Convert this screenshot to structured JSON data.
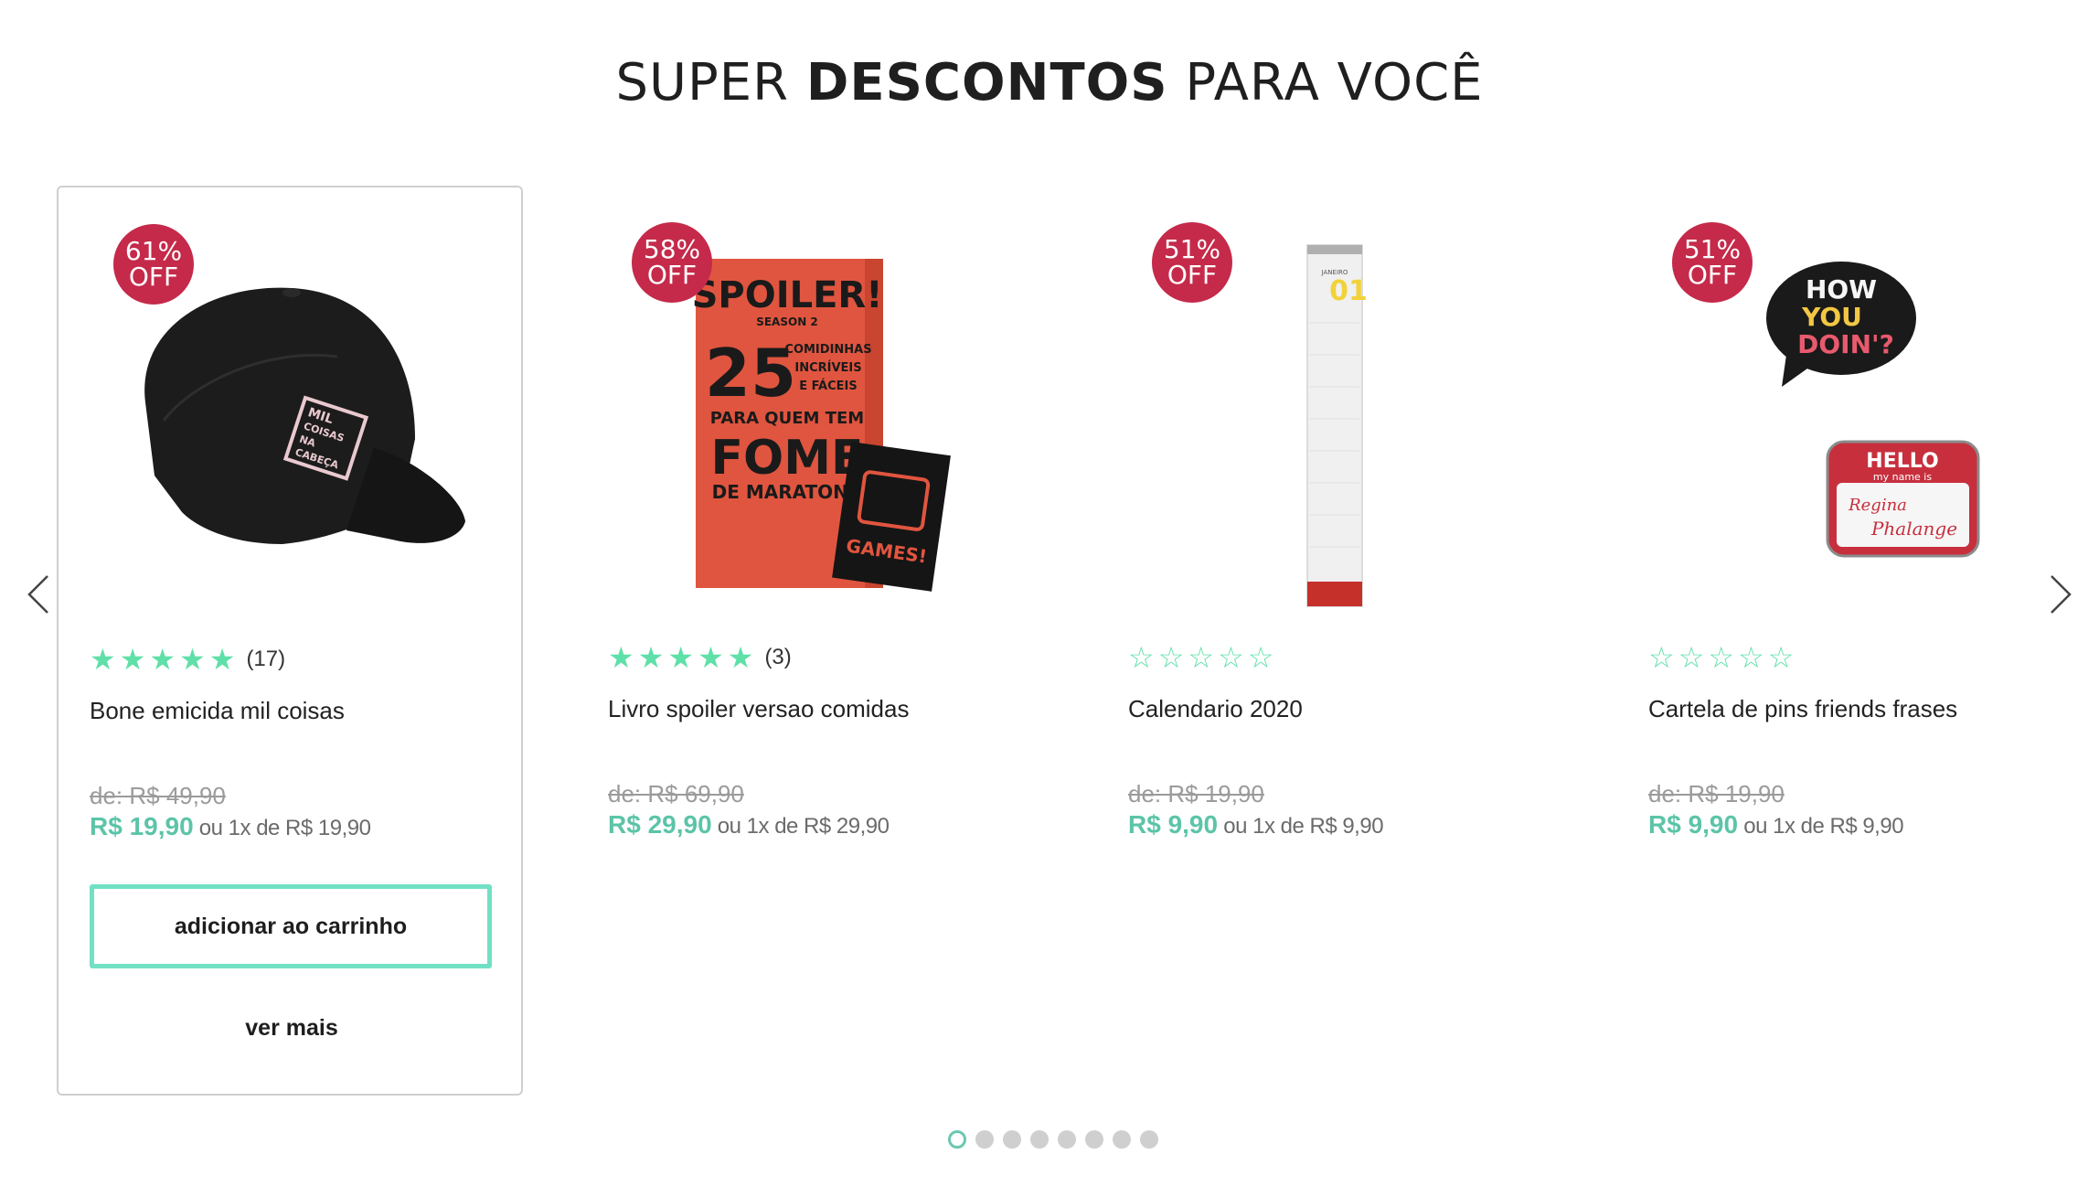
{
  "section": {
    "title_light": "SUPER ",
    "title_bold": "DESCONTOS",
    "title_end": " PARA VOCÊ"
  },
  "colors": {
    "badge": "#c52a4a",
    "accent": "#5cc4a8",
    "button_border": "#72e0c4",
    "star": "#5fe0a8"
  },
  "products": [
    {
      "badge_pct": "61%",
      "badge_off": "OFF",
      "rating": 5,
      "rating_count": "(17)",
      "name": "Bone emicida mil coisas",
      "old_price": "de: R$ 49,90",
      "new_price": "R$ 19,90",
      "installment": " ou 1x de R$ 19,90",
      "cap_text_1": "MIL",
      "cap_text_2": "COISAS",
      "cap_text_3": "NA",
      "cap_text_4": "CABEÇA"
    },
    {
      "badge_pct": "58%",
      "badge_off": "OFF",
      "rating": 5,
      "rating_count": "(3)",
      "name": "Livro spoiler versao comidas",
      "old_price": "de: R$ 69,90",
      "new_price": "R$ 29,90",
      "installment": " ou 1x de R$ 29,90",
      "book_l1": "SPOILER!",
      "book_l2": "SEASON 2",
      "book_l3": "25",
      "book_l4": "COMIDINHAS",
      "book_l5": "INCRÍVEIS",
      "book_l6": "E FÁCEIS",
      "book_l7": "PARA QUEM TEM",
      "book_l8": "FOME",
      "book_l9": "DE MARATONA",
      "box_text": "GAMES!"
    },
    {
      "badge_pct": "51%",
      "badge_off": "OFF",
      "rating": 0,
      "rating_count": "",
      "name": "Calendario 2020",
      "old_price": "de: R$ 19,90",
      "new_price": "R$ 9,90",
      "installment": " ou 1x de R$ 9,90",
      "cal_month": "JANEIRO",
      "cal_num": "01"
    },
    {
      "badge_pct": "51%",
      "badge_off": "OFF",
      "rating": 0,
      "rating_count": "",
      "name": "Cartela de pins friends frases",
      "old_price": "de: R$ 19,90",
      "new_price": "R$ 9,90",
      "installment": " ou 1x de R$ 9,90",
      "pin1_l1": "HOW",
      "pin1_l2": "YOU",
      "pin1_l3": "DOIN'?",
      "pin2_l1": "HELLO",
      "pin2_l2": "my name is",
      "pin2_l3": "Regina",
      "pin2_l4": "Phalange"
    }
  ],
  "actions": {
    "add_to_cart": "adicionar ao carrinho",
    "see_more": "ver mais"
  },
  "pagination": {
    "count": 8,
    "active": 0
  },
  "icons": {
    "prev": "chevron-left-icon",
    "next": "chevron-right-icon",
    "star": "star-icon"
  }
}
